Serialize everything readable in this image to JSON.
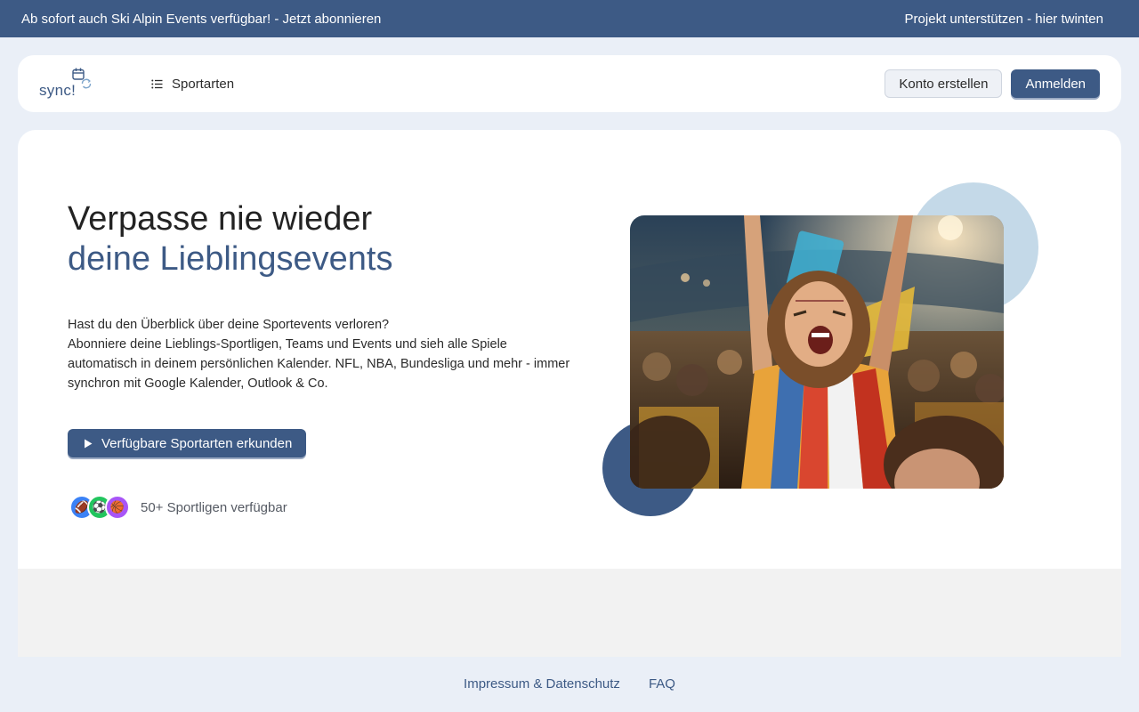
{
  "topbar": {
    "announcement": "Ab sofort auch Ski Alpin Events verfügbar! - Jetzt abonnieren",
    "support": "Projekt unterstützen - hier twinten"
  },
  "header": {
    "logo_text": "sync!",
    "nav_sports": "Sportarten",
    "create_account": "Konto erstellen",
    "login": "Anmelden"
  },
  "hero": {
    "title_line1": "Verpasse nie wieder",
    "title_line2": "deine Lieblingsevents",
    "desc_line1": "Hast du den Überblick über deine Sportevents verloren?",
    "desc_line2": "Abonniere deine Lieblings-Sportligen, Teams und Events und sieh alle Spiele automatisch in deinem persönlichen Kalender. NFL, NBA, Bundesliga und mehr - immer synchron mit Google Kalender, Outlook & Co.",
    "cta": "Verfügbare Sportarten erkunden",
    "leagues_text": "50+ Sportligen verfügbar",
    "league_icons": [
      "american-football-icon",
      "soccer-ball-icon",
      "basketball-icon"
    ]
  },
  "footer": {
    "imprint": "Impressum & Datenschutz",
    "faq": "FAQ"
  },
  "colors": {
    "primary": "#3d5a85",
    "light_accent": "#c4d9e8",
    "page_bg": "#eaeff7"
  }
}
